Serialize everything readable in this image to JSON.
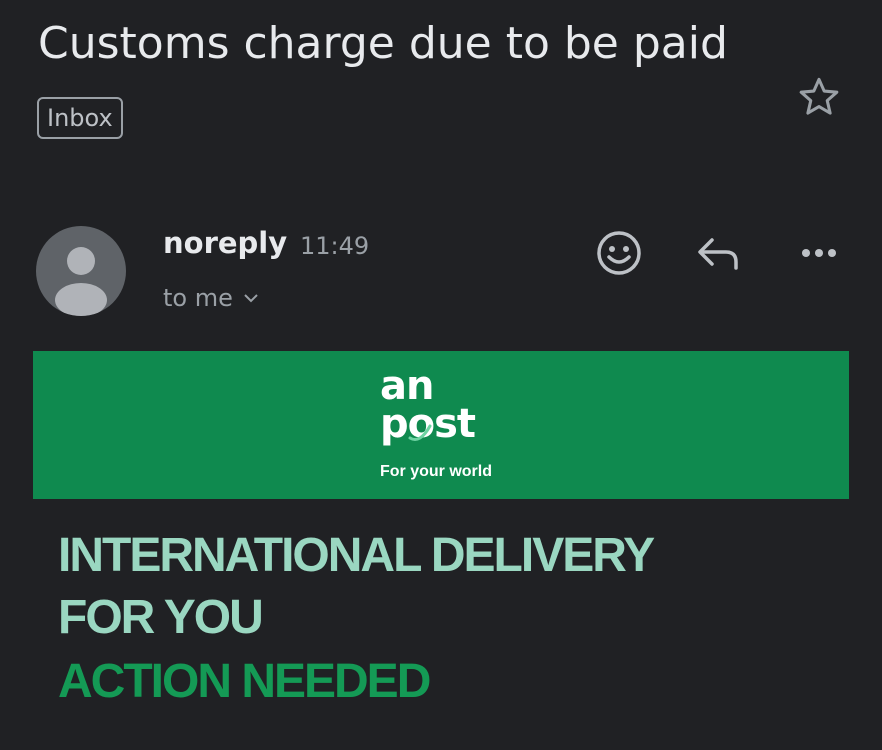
{
  "email": {
    "subject": "Customs charge due to be paid",
    "label": "Inbox",
    "sender": "noreply",
    "time": "11:49",
    "recipient": "to me"
  },
  "icons": {
    "star": "star-outline-icon",
    "emoji": "add-reaction-icon",
    "reply": "reply-icon",
    "more": "more-horiz-icon",
    "avatar": "default-avatar-icon"
  },
  "body": {
    "logo_line1": "an",
    "logo_line2": "post",
    "tagline": "For your world",
    "headline_1": "INTERNATIONAL DELIVERY",
    "headline_2": "FOR YOU",
    "headline_3": "ACTION NEEDED"
  },
  "colors": {
    "background": "#202124",
    "banner_green": "#0f8a4f",
    "headline_light": "#9ad7c1",
    "headline_accent": "#149a55"
  }
}
